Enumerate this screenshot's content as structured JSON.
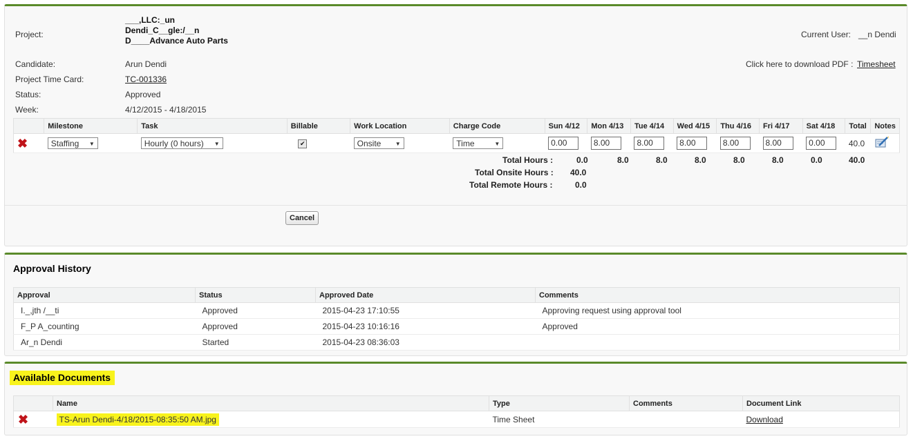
{
  "timecard": {
    "project_label": "Project:",
    "project_lines": [
      "___,LLC:_un",
      "Dendi_C__gle:/__n",
      "D____Advance Auto Parts"
    ],
    "current_user_label": "Current User:",
    "current_user_value": "__n Dendi",
    "candidate_label": "Candidate:",
    "candidate_value": "Arun Dendi",
    "pdf_label": "Click here to download PDF :",
    "pdf_link": "Timesheet",
    "ptc_label": "Project Time Card:",
    "ptc_value": "TC-001336",
    "status_label": "Status:",
    "status_value": "Approved",
    "week_label": "Week:",
    "week_value": "4/12/2015 - 4/18/2015",
    "columns": [
      "Milestone",
      "Task",
      "Billable",
      "Work Location",
      "Charge Code",
      "Sun 4/12",
      "Mon 4/13",
      "Tue 4/14",
      "Wed 4/15",
      "Thu 4/16",
      "Fri 4/17",
      "Sat 4/18",
      "Total",
      "Notes"
    ],
    "row": {
      "milestone": "Staffing",
      "task": "Hourly (0 hours)",
      "billable": true,
      "work_location": "Onsite",
      "charge_code": "Time",
      "hours": [
        "0.00",
        "8.00",
        "8.00",
        "8.00",
        "8.00",
        "8.00",
        "0.00"
      ],
      "total": "40.0"
    },
    "total_hours_label": "Total Hours :",
    "total_hours": [
      "0.0",
      "8.0",
      "8.0",
      "8.0",
      "8.0",
      "8.0",
      "0.0",
      "40.0"
    ],
    "total_onsite_label": "Total Onsite Hours :",
    "total_onsite_value": "40.0",
    "total_remote_label": "Total Remote Hours :",
    "total_remote_value": "0.0",
    "cancel_button": "Cancel"
  },
  "approval_history": {
    "title": "Approval History",
    "columns": [
      "Approval",
      "Status",
      "Approved Date",
      "Comments"
    ],
    "rows": [
      {
        "approval": "I._,jth /__ti",
        "status": "Approved",
        "date": "2015-04-23 17:10:55",
        "comments": "Approving request using approval tool"
      },
      {
        "approval": "F_P A_counting",
        "status": "Approved",
        "date": "2015-04-23 10:16:16",
        "comments": "Approved"
      },
      {
        "approval": "Ar_n Dendi",
        "status": "Started",
        "date": "2015-04-23 08:36:03",
        "comments": ""
      }
    ]
  },
  "documents": {
    "title": "Available Documents",
    "columns": [
      "",
      "Name",
      "Type",
      "Comments",
      "Document Link"
    ],
    "rows": [
      {
        "name": "TS-Arun Dendi-4/18/2015-08:35:50 AM.jpg",
        "type": "Time Sheet",
        "comments": "",
        "link": "Download"
      }
    ]
  },
  "colors": {
    "accent": "#5a8a2a",
    "delete": "#c0141a",
    "highlight": "#f8f31c"
  }
}
